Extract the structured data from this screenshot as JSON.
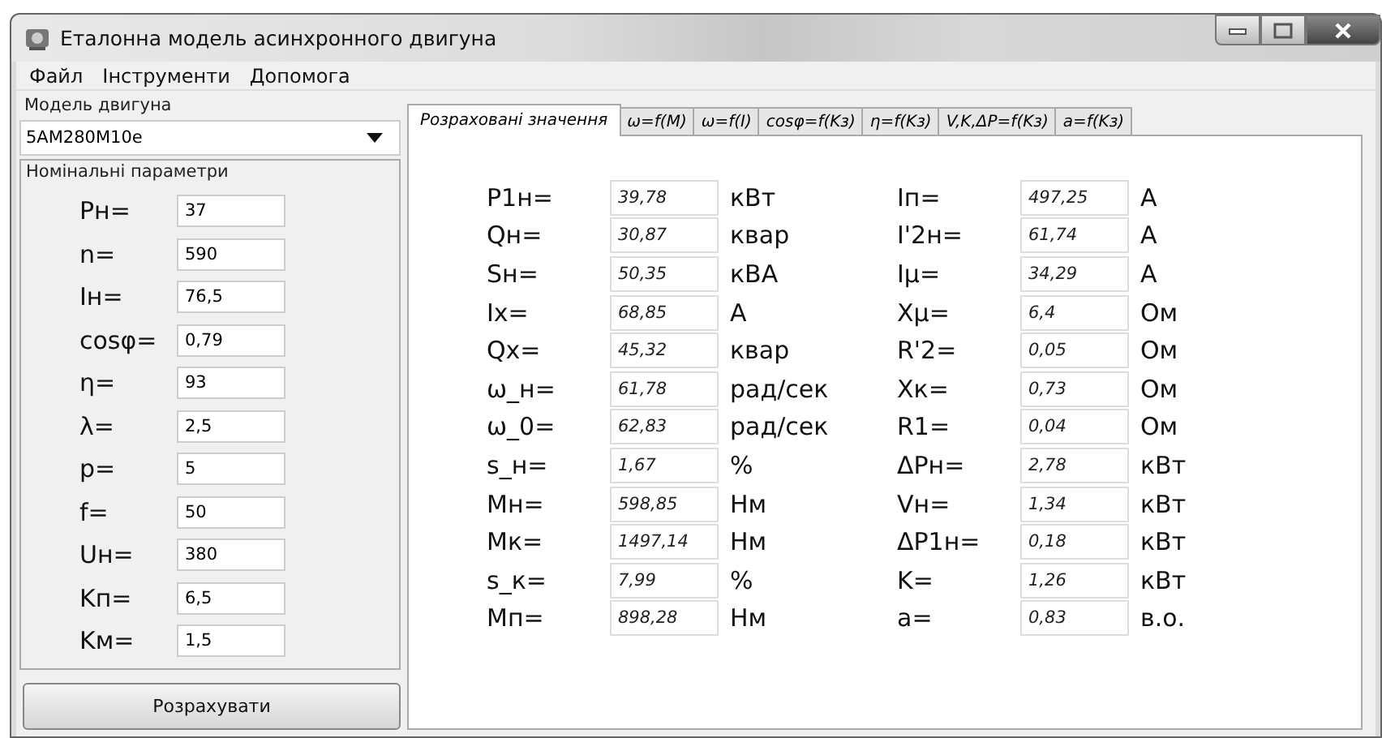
{
  "window": {
    "title": "Еталонна модель асинхронного двигуна"
  },
  "menu": [
    "Файл",
    "Інструменти",
    "Допомога"
  ],
  "model": {
    "label": "Модель двигуна",
    "value": "5AM280M10e"
  },
  "nominal": {
    "title": "Номінальні параметри",
    "params": [
      {
        "label": "Pн=",
        "value": "37"
      },
      {
        "label": "n=",
        "value": "590"
      },
      {
        "label": "Iн=",
        "value": "76,5"
      },
      {
        "label": "cosφ=",
        "value": "0,79"
      },
      {
        "label": "η=",
        "value": "93"
      },
      {
        "label": "λ=",
        "value": "2,5"
      },
      {
        "label": "p=",
        "value": "5"
      },
      {
        "label": "f=",
        "value": "50"
      },
      {
        "label": "Uн=",
        "value": "380"
      },
      {
        "label": "Kп=",
        "value": "6,5"
      },
      {
        "label": "Kм=",
        "value": "1,5"
      }
    ]
  },
  "calculate_button": "Розрахувати",
  "tabs": [
    {
      "label": "Розраховані значення",
      "selected": true
    },
    {
      "label": "ω=f(M)",
      "selected": false
    },
    {
      "label": "ω=f(I)",
      "selected": false
    },
    {
      "label": "cosφ=f(Kз)",
      "selected": false
    },
    {
      "label": "η=f(Kз)",
      "selected": false
    },
    {
      "label": "V,K,ΔP=f(Kз)",
      "selected": false
    },
    {
      "label": "a=f(Kз)",
      "selected": false
    }
  ],
  "results": [
    [
      {
        "label": "P1н=",
        "value": "39,78",
        "unit": "кВт"
      },
      {
        "label": "Qн=",
        "value": "30,87",
        "unit": "квар"
      },
      {
        "label": "Sн=",
        "value": "50,35",
        "unit": "кВА"
      },
      {
        "label": "Ix=",
        "value": "68,85",
        "unit": "А"
      },
      {
        "label": "Qx=",
        "value": "45,32",
        "unit": "квар"
      },
      {
        "label": "ω_н=",
        "value": "61,78",
        "unit": "рад/сек"
      },
      {
        "label": "ω_0=",
        "value": "62,83",
        "unit": "рад/сек"
      },
      {
        "label": "s_н=",
        "value": "1,67",
        "unit": "%"
      },
      {
        "label": "Мн=",
        "value": "598,85",
        "unit": "Нм"
      },
      {
        "label": "Мк=",
        "value": "1497,14",
        "unit": "Нм"
      },
      {
        "label": "s_к=",
        "value": "7,99",
        "unit": "%"
      },
      {
        "label": "Мп=",
        "value": "898,28",
        "unit": "Нм"
      }
    ],
    [
      {
        "label": "Iп=",
        "value": "497,25",
        "unit": "А"
      },
      {
        "label": "I'2н=",
        "value": "61,74",
        "unit": "А"
      },
      {
        "label": "Iμ=",
        "value": "34,29",
        "unit": "А"
      },
      {
        "label": "Xμ=",
        "value": "6,4",
        "unit": "Ом"
      },
      {
        "label": "R'2=",
        "value": "0,05",
        "unit": "Ом"
      },
      {
        "label": "Xк=",
        "value": "0,73",
        "unit": "Ом"
      },
      {
        "label": "R1=",
        "value": "0,04",
        "unit": "Ом"
      },
      {
        "label": "ΔPн=",
        "value": "2,78",
        "unit": "кВт"
      },
      {
        "label": "Vн=",
        "value": "1,34",
        "unit": "кВт"
      },
      {
        "label": "ΔP1н=",
        "value": "0,18",
        "unit": "кВт"
      },
      {
        "label": "K=",
        "value": "1,26",
        "unit": "кВт"
      },
      {
        "label": "a=",
        "value": "0,83",
        "unit": "в.о."
      }
    ]
  ]
}
